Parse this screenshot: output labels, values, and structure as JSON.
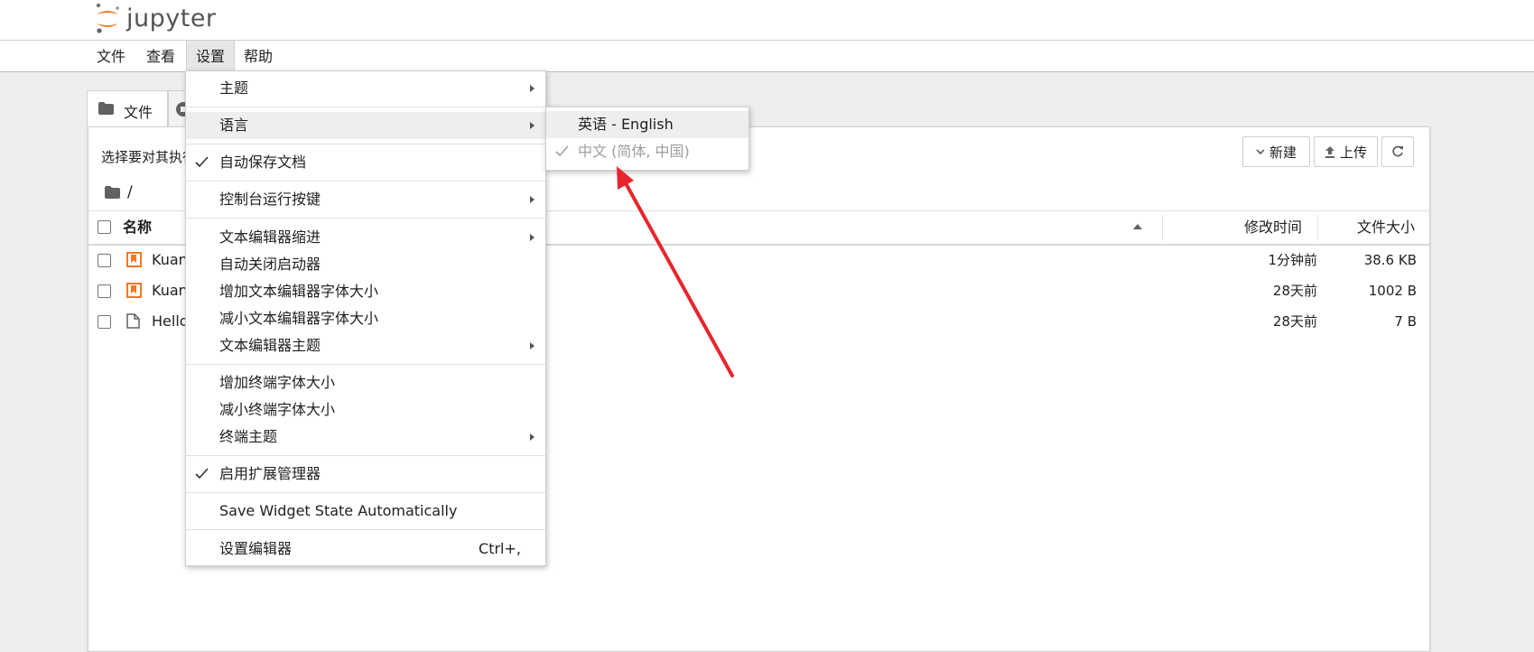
{
  "header": {
    "logo_text": "jupyter"
  },
  "menubar": {
    "items": [
      "文件",
      "查看",
      "设置",
      "帮助"
    ]
  },
  "tabs": {
    "files_label": "文件"
  },
  "filebrowser": {
    "hint": "选择要对其执行",
    "new_label": "新建",
    "upload_label": "上传",
    "crumb": "/",
    "columns": {
      "name": "名称",
      "modified": "修改时间",
      "size": "文件大小"
    },
    "rows": [
      {
        "name": "Kuan",
        "modified": "1分钟前",
        "size": "38.6 KB",
        "icon": "notebook-icon"
      },
      {
        "name": "Kuan",
        "modified": "28天前",
        "size": "1002 B",
        "icon": "notebook-icon"
      },
      {
        "name": "Hello",
        "modified": "28天前",
        "size": "7 B",
        "icon": "file-icon"
      }
    ]
  },
  "settings_menu": {
    "items": [
      {
        "label": "主题"
      },
      {
        "label": "语言"
      },
      {
        "label": "自动保存文档"
      },
      {
        "label": "控制台运行按键"
      },
      {
        "label": "文本编辑器缩进"
      },
      {
        "label": "自动关闭启动器"
      },
      {
        "label": "增加文本编辑器字体大小"
      },
      {
        "label": "减小文本编辑器字体大小"
      },
      {
        "label": "文本编辑器主题"
      },
      {
        "label": "增加终端字体大小"
      },
      {
        "label": "减小终端字体大小"
      },
      {
        "label": "终端主题"
      },
      {
        "label": "启用扩展管理器"
      },
      {
        "label": "Save Widget State Automatically"
      },
      {
        "label": "设置编辑器",
        "shortcut": "Ctrl+,"
      }
    ]
  },
  "language_submenu": {
    "items": [
      {
        "label": "英语 - English"
      },
      {
        "label": "中文 (简体, 中国)"
      }
    ]
  },
  "colors": {
    "jupyter_orange": "#f37726",
    "annotation_arrow": "#e8262e"
  }
}
